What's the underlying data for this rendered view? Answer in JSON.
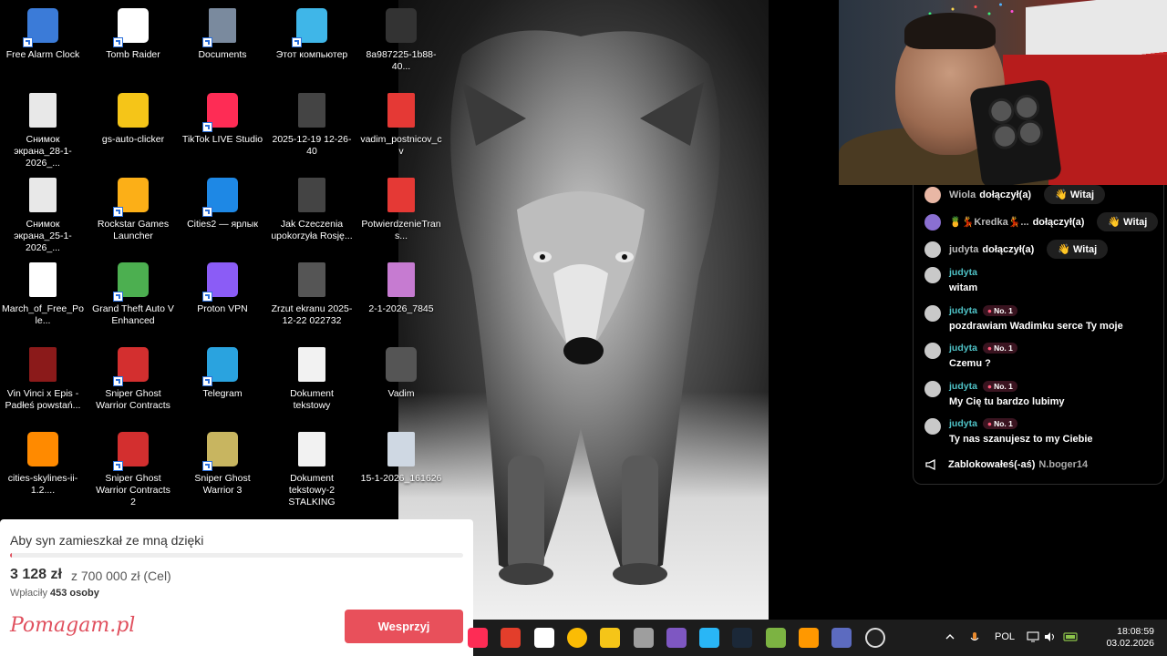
{
  "desktop": {
    "icons": [
      {
        "label": "Free Alarm Clock",
        "icon": "alarm-clock-icon",
        "col": 0,
        "row": 0,
        "shortcut": true,
        "color": "#3b7bd8"
      },
      {
        "label": "Tomb Raider",
        "icon": "tomb-raider-icon",
        "col": 1,
        "row": 0,
        "shortcut": true,
        "color": "#ffffff"
      },
      {
        "label": "Documents",
        "icon": "folder-documents-icon",
        "col": 2,
        "row": 0,
        "shortcut": true,
        "color": "#7a8a9e"
      },
      {
        "label": "Этот компьютер",
        "icon": "this-pc-icon",
        "col": 3,
        "row": 0,
        "shortcut": true,
        "color": "#3fb6e8"
      },
      {
        "label": "8a987225-1b88-40...",
        "icon": "phone-image-icon",
        "col": 4,
        "row": 0,
        "shortcut": false,
        "color": "#333333"
      },
      {
        "label": "Снимок экрана_28-1-2026_...",
        "icon": "screenshot-file-icon",
        "col": 0,
        "row": 1,
        "shortcut": false,
        "color": "#e8e8e8"
      },
      {
        "label": "gs-auto-clicker",
        "icon": "auto-clicker-icon",
        "col": 1,
        "row": 1,
        "shortcut": false,
        "color": "#f5c518"
      },
      {
        "label": "TikTok LIVE Studio",
        "icon": "tiktok-live-studio-icon",
        "col": 2,
        "row": 1,
        "shortcut": true,
        "color": "#fe2c55"
      },
      {
        "label": "2025-12-19 12-26-40",
        "icon": "video-file-icon",
        "col": 3,
        "row": 1,
        "shortcut": false,
        "color": "#444444"
      },
      {
        "label": "vadim_postnicov_cv",
        "icon": "pdf-file-icon",
        "col": 4,
        "row": 1,
        "shortcut": false,
        "color": "#e53935"
      },
      {
        "label": "Снимок экрана_25-1-2026_...",
        "icon": "screenshot-file-icon",
        "col": 0,
        "row": 2,
        "shortcut": false,
        "color": "#e8e8e8"
      },
      {
        "label": "Rockstar Games Launcher",
        "icon": "rockstar-launcher-icon",
        "col": 1,
        "row": 2,
        "shortcut": true,
        "color": "#fcaf17"
      },
      {
        "label": "Cities2 — ярлык",
        "icon": "cities2-icon",
        "col": 2,
        "row": 2,
        "shortcut": true,
        "color": "#1e88e5"
      },
      {
        "label": "Jak Czeczenia upokorzyła Rosję...",
        "icon": "video-file-icon",
        "col": 3,
        "row": 2,
        "shortcut": false,
        "color": "#444444"
      },
      {
        "label": "PotwierdzenieTrans...",
        "icon": "pdf-file-icon",
        "col": 4,
        "row": 2,
        "shortcut": false,
        "color": "#e53935"
      },
      {
        "label": "March_of_Free_Pole...",
        "icon": "media-file-icon",
        "col": 0,
        "row": 3,
        "shortcut": false,
        "color": "#ffffff"
      },
      {
        "label": "Grand Theft Auto V Enhanced",
        "icon": "gta-v-icon",
        "col": 1,
        "row": 3,
        "shortcut": true,
        "color": "#4caf50"
      },
      {
        "label": "Proton VPN",
        "icon": "proton-vpn-icon",
        "col": 2,
        "row": 3,
        "shortcut": true,
        "color": "#8b5cf6"
      },
      {
        "label": "Zrzut ekranu 2025-12-22 022732",
        "icon": "image-file-icon",
        "col": 3,
        "row": 3,
        "shortcut": false,
        "color": "#555555"
      },
      {
        "label": "2-1-2026_7845",
        "icon": "image-file-icon",
        "col": 4,
        "row": 3,
        "shortcut": false,
        "color": "#c67bd1"
      },
      {
        "label": "Vin Vinci x Epis - Padłeś powstań...",
        "icon": "video-file-icon",
        "col": 0,
        "row": 4,
        "shortcut": false,
        "color": "#8b1a1a"
      },
      {
        "label": "Sniper Ghost Warrior Contracts",
        "icon": "sgw-contracts-icon",
        "col": 1,
        "row": 4,
        "shortcut": true,
        "color": "#d32f2f"
      },
      {
        "label": "Telegram",
        "icon": "telegram-icon",
        "col": 2,
        "row": 4,
        "shortcut": true,
        "color": "#2aa3df"
      },
      {
        "label": "Dokument tekstowy",
        "icon": "text-file-icon",
        "col": 3,
        "row": 4,
        "shortcut": false,
        "color": "#f2f2f2"
      },
      {
        "label": "Vadim",
        "icon": "wolf-image-icon",
        "col": 4,
        "row": 4,
        "shortcut": false,
        "color": "#555555"
      },
      {
        "label": "cities-skylines-ii-1.2....",
        "icon": "rocket-icon",
        "col": 0,
        "row": 5,
        "shortcut": false,
        "color": "#ff8a00"
      },
      {
        "label": "Sniper Ghost Warrior Contracts 2",
        "icon": "sgw-contracts-2-icon",
        "col": 1,
        "row": 5,
        "shortcut": true,
        "color": "#d32f2f"
      },
      {
        "label": "Sniper Ghost Warrior 3",
        "icon": "sgw3-icon",
        "col": 2,
        "row": 5,
        "shortcut": true,
        "color": "#c8b560"
      },
      {
        "label": "Dokument tekstowy-2 STALKING",
        "icon": "text-file-icon",
        "col": 3,
        "row": 5,
        "shortcut": false,
        "color": "#f2f2f2"
      },
      {
        "label": "15-1-2026_161626",
        "icon": "screenshot-file-icon",
        "col": 4,
        "row": 5,
        "shortcut": false,
        "color": "#cfd8e3"
      }
    ]
  },
  "chat": {
    "joins": [
      {
        "user": "Wiola",
        "action": "dołączył(a)",
        "button": "👋 Witaj"
      },
      {
        "user": "🍍💃Kredka💃...",
        "action": "dołączył(a)",
        "button": "👋 Witaj"
      },
      {
        "user": "judyta",
        "action": "dołączył(a)",
        "button": "👋 Witaj"
      }
    ],
    "messages": [
      {
        "user": "judyta",
        "badge": "",
        "text": "witam"
      },
      {
        "user": "judyta",
        "badge": "No. 1",
        "text": "pozdrawiam Wadimku serce Ty moje"
      },
      {
        "user": "judyta",
        "badge": "No. 1",
        "text": "Czemu ?"
      },
      {
        "user": "judyta",
        "badge": "No. 1",
        "text": "My Cię tu bardzo lubimy"
      },
      {
        "user": "judyta",
        "badge": "No. 1",
        "text": "Ty nas szanujesz to my Ciebie"
      }
    ],
    "blocked": {
      "text": "Zablokowałeś(-aś)",
      "user": "N.boger14"
    }
  },
  "fundraiser": {
    "title": "Aby syn zamieszkał ze mną dzięki",
    "raised": "3 128 zł",
    "goal": "z 700 000 zł (Cel)",
    "payers_label": "Wpłaciły",
    "payers_count": "453 osoby",
    "progress": 0.0045,
    "brand": "Pomagam.pl",
    "button": "Wesprzyj",
    "accent": "#e8505b"
  },
  "taskbar": {
    "apps": [
      "tiktok-icon",
      "rockstar-icon",
      "notes-icon",
      "chrome-icon",
      "auto-clicker-icon",
      "box-icon",
      "gallery-icon",
      "photos-icon",
      "steam-icon",
      "game-icon",
      "media-player-icon",
      "teams-icon",
      "obs-icon"
    ],
    "language": "POL",
    "time": "18:08:59",
    "date": "03.02.2026"
  }
}
